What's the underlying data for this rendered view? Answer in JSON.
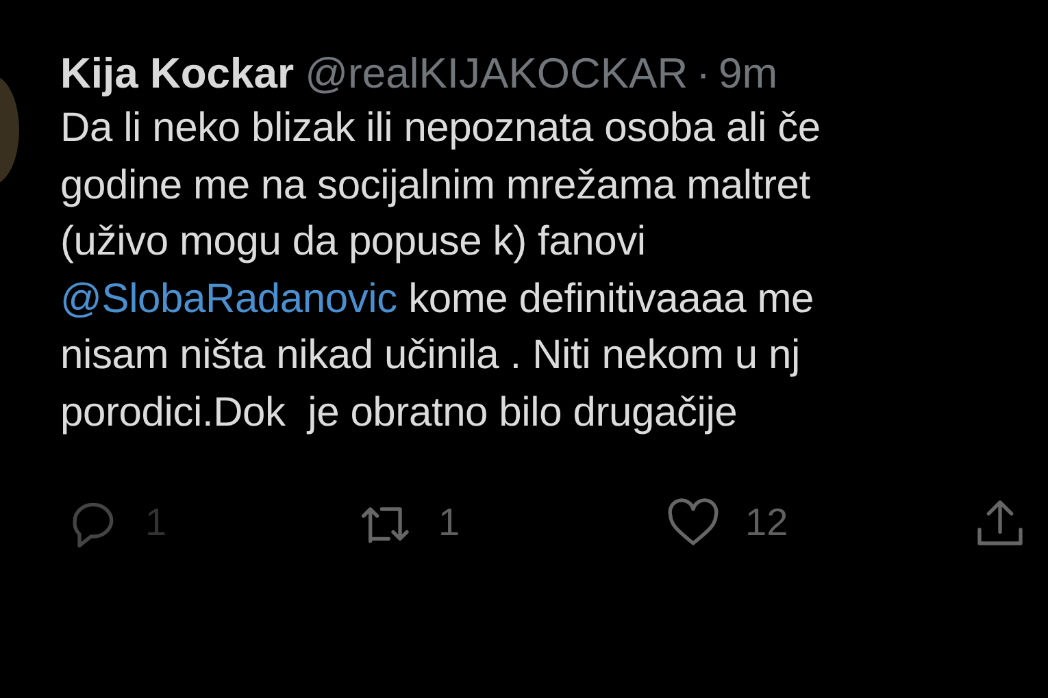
{
  "tweet": {
    "author_name": "Kija Kockar",
    "handle": "@realKIJAKOCKAR",
    "separator": "·",
    "time": "9m",
    "lines": [
      {
        "kind": "text",
        "text": "Da li neko blizak ili nepoznata osoba ali če"
      },
      {
        "kind": "text",
        "text": "godine me na socijalnim mrežama maltret"
      },
      {
        "kind": "text",
        "text": "(uživo mogu da popuse k) fanovi"
      },
      {
        "kind": "mention",
        "mention": "@SlobaRadanovic",
        "text": " kome definitivaaaa me"
      },
      {
        "kind": "text",
        "text": "nisam ništa nikad učinila . Niti nekom u nj"
      },
      {
        "kind": "text",
        "text": "porodici.Dok  je obratno bilo drugačije"
      }
    ],
    "actions": [
      {
        "kind": "reply",
        "count": "1"
      },
      {
        "kind": "retweet",
        "count": "1"
      },
      {
        "kind": "like",
        "count": "12"
      },
      {
        "kind": "share"
      }
    ]
  }
}
